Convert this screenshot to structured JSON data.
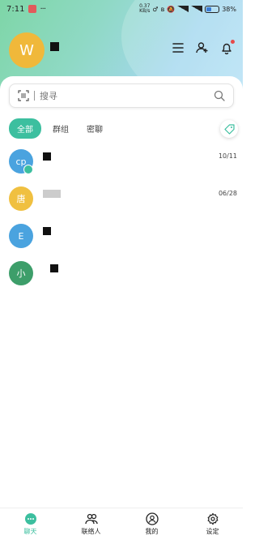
{
  "status_bar": {
    "time": "7:11",
    "dots": "···",
    "net_speed_value": "0.37",
    "net_speed_unit": "KB/s",
    "battery": "38"
  },
  "header": {
    "avatar_letter": "W"
  },
  "search": {
    "placeholder": "搜寻"
  },
  "filter_tabs": [
    {
      "label": "全部",
      "active": true
    },
    {
      "label": "群组",
      "active": false
    },
    {
      "label": "密聊",
      "active": false
    }
  ],
  "chats": [
    {
      "avatar_text": "cp",
      "avatar_color": "#4aa3df",
      "time": "10/11",
      "is_group": true
    },
    {
      "avatar_text": "唐",
      "avatar_color": "#f0c040",
      "time": "06/28",
      "is_group": false
    },
    {
      "avatar_text": "E",
      "avatar_color": "#4aa3df",
      "time": "",
      "is_group": false
    },
    {
      "avatar_text": "小",
      "avatar_color": "#3d9e6a",
      "time": "",
      "is_group": false
    }
  ],
  "bottom_nav": [
    {
      "label": "聊天",
      "icon": "chat-bubble-icon",
      "active": true
    },
    {
      "label": "联络人",
      "icon": "contacts-icon",
      "active": false
    },
    {
      "label": "我的",
      "icon": "profile-icon",
      "active": false
    },
    {
      "label": "设定",
      "icon": "settings-gear-icon",
      "active": false
    }
  ],
  "colors": {
    "accent": "#3cbf9f",
    "avatar_main": "#f0b83a",
    "notification_dot": "#e64a4a"
  }
}
